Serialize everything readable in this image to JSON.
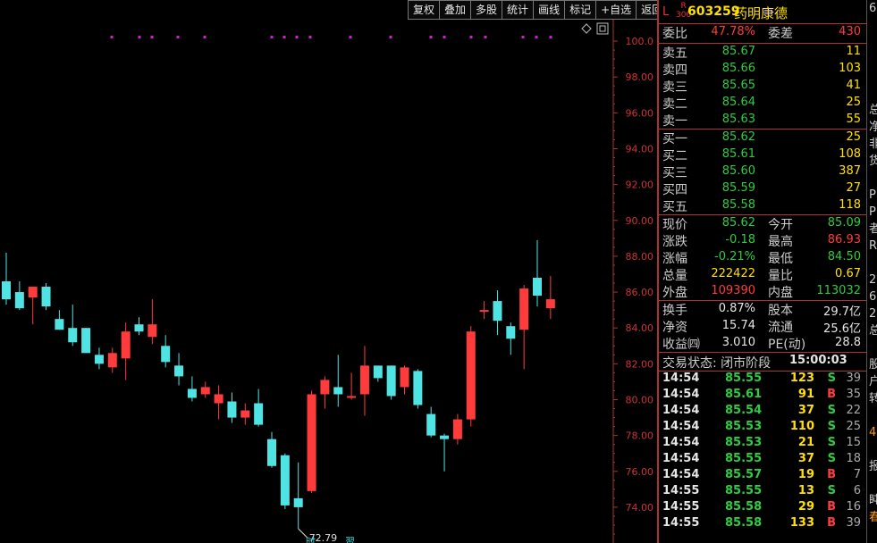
{
  "toolbar": {
    "buttons": [
      "复权",
      "叠加",
      "多股",
      "统计",
      "画线",
      "标记",
      "+自选",
      "返回"
    ]
  },
  "stock": {
    "market_l": "L",
    "market_r_top": "R",
    "market_r_bottom": "300",
    "code": "603259",
    "name": "药明康德"
  },
  "bid_ask_summary": {
    "ratio_label": "委比",
    "ratio_value": "47.78%",
    "diff_label": "委差",
    "diff_value": "430"
  },
  "asks": [
    {
      "label": "卖五",
      "price": "85.67",
      "vol": "11"
    },
    {
      "label": "卖四",
      "price": "85.66",
      "vol": "103"
    },
    {
      "label": "卖三",
      "price": "85.65",
      "vol": "41"
    },
    {
      "label": "卖二",
      "price": "85.64",
      "vol": "25"
    },
    {
      "label": "卖一",
      "price": "85.63",
      "vol": "55"
    }
  ],
  "bids": [
    {
      "label": "买一",
      "price": "85.62",
      "vol": "25"
    },
    {
      "label": "买二",
      "price": "85.61",
      "vol": "108"
    },
    {
      "label": "买三",
      "price": "85.60",
      "vol": "387"
    },
    {
      "label": "买四",
      "price": "85.59",
      "vol": "27"
    },
    {
      "label": "买五",
      "price": "85.58",
      "vol": "118"
    }
  ],
  "quote": [
    {
      "l1": "现价",
      "v1": "85.62",
      "c1": "green",
      "l2": "今开",
      "v2": "85.09",
      "c2": "green"
    },
    {
      "l1": "涨跌",
      "v1": "-0.18",
      "c1": "green",
      "l2": "最高",
      "v2": "86.93",
      "c2": "red"
    },
    {
      "l1": "涨幅",
      "v1": "-0.21%",
      "c1": "green",
      "l2": "最低",
      "v2": "84.50",
      "c2": "green"
    },
    {
      "l1": "总量",
      "v1": "222422",
      "c1": "yellow",
      "l2": "量比",
      "v2": "0.67",
      "c2": "yellow"
    },
    {
      "l1": "外盘",
      "v1": "109390",
      "c1": "red",
      "l2": "内盘",
      "v2": "113032",
      "c2": "green"
    }
  ],
  "fundamentals": [
    {
      "l1": "换手",
      "v1": "0.87%",
      "l2": "股本",
      "v2": "29.7亿"
    },
    {
      "l1": "净资",
      "v1": "15.74",
      "l2": "流通",
      "v2": "25.6亿"
    },
    {
      "l1": "收益㈣",
      "v1": "3.010",
      "l2": "PE(动)",
      "v2": "28.8"
    }
  ],
  "status": {
    "label": "交易状态: 闭市阶段",
    "time": "15:00:03"
  },
  "ticks": [
    {
      "time": "14:54",
      "price": "85.55",
      "vol": "123",
      "bs": "S",
      "n": "39"
    },
    {
      "time": "14:54",
      "price": "85.61",
      "vol": "91",
      "bs": "B",
      "n": "35"
    },
    {
      "time": "14:54",
      "price": "85.54",
      "vol": "37",
      "bs": "S",
      "n": "22"
    },
    {
      "time": "14:54",
      "price": "85.53",
      "vol": "110",
      "bs": "S",
      "n": "25"
    },
    {
      "time": "14:54",
      "price": "85.53",
      "vol": "21",
      "bs": "S",
      "n": "15"
    },
    {
      "time": "14:54",
      "price": "85.55",
      "vol": "37",
      "bs": "S",
      "n": "18"
    },
    {
      "time": "14:54",
      "price": "85.57",
      "vol": "19",
      "bs": "B",
      "n": "7"
    },
    {
      "time": "14:55",
      "price": "85.55",
      "vol": "13",
      "bs": "S",
      "n": "6"
    },
    {
      "time": "14:55",
      "price": "85.58",
      "vol": "29",
      "bs": "B",
      "n": "16"
    },
    {
      "time": "14:55",
      "price": "85.58",
      "vol": "133",
      "bs": "B",
      "n": "39"
    }
  ],
  "right_strip": [
    "6",
    "",
    "",
    "",
    "",
    "",
    "总",
    "净",
    "非",
    "货",
    "",
    "P",
    "P",
    "者",
    "R",
    "",
    "2",
    "6",
    "2",
    "总",
    "",
    "股",
    "户",
    "转",
    "",
    "4",
    "",
    "报",
    "",
    "盹",
    "春"
  ],
  "colors": {
    "up": "#ff3b3b",
    "down": "#4fe3e3",
    "axis": "#a33",
    "grid_label": "#c33",
    "marker": "#d020d0"
  },
  "chart_data": {
    "type": "candlestick",
    "y_axis_ticks": [
      "100.0",
      "98.00",
      "96.00",
      "94.00",
      "92.00",
      "90.00",
      "88.00",
      "86.00",
      "84.00",
      "82.00",
      "80.00",
      "78.00",
      "76.00",
      "74.00"
    ],
    "ylim": [
      73.0,
      100.6
    ],
    "min_label": "72.79",
    "bottom_labels": [
      "时",
      "習"
    ],
    "candles": [
      {
        "o": 86.6,
        "h": 88.2,
        "l": 85.3,
        "c": 85.6
      },
      {
        "o": 86.0,
        "h": 86.6,
        "l": 85.0,
        "c": 85.1
      },
      {
        "o": 85.7,
        "h": 86.3,
        "l": 84.2,
        "c": 86.3
      },
      {
        "o": 86.3,
        "h": 86.5,
        "l": 85.0,
        "c": 85.2
      },
      {
        "o": 84.5,
        "h": 85.0,
        "l": 83.9,
        "c": 83.9
      },
      {
        "o": 84.0,
        "h": 85.3,
        "l": 83.0,
        "c": 83.2
      },
      {
        "o": 84.0,
        "h": 84.0,
        "l": 82.6,
        "c": 82.6
      },
      {
        "o": 82.5,
        "h": 82.9,
        "l": 81.7,
        "c": 82.0
      },
      {
        "o": 81.8,
        "h": 82.9,
        "l": 81.5,
        "c": 82.6
      },
      {
        "o": 82.3,
        "h": 84.3,
        "l": 81.1,
        "c": 83.8
      },
      {
        "o": 84.2,
        "h": 84.6,
        "l": 83.6,
        "c": 83.8
      },
      {
        "o": 83.5,
        "h": 85.6,
        "l": 83.1,
        "c": 84.2
      },
      {
        "o": 83.0,
        "h": 83.6,
        "l": 81.8,
        "c": 82.1
      },
      {
        "o": 81.9,
        "h": 82.6,
        "l": 80.8,
        "c": 81.3
      },
      {
        "o": 80.6,
        "h": 81.3,
        "l": 79.9,
        "c": 80.1
      },
      {
        "o": 80.3,
        "h": 81.0,
        "l": 80.1,
        "c": 80.7
      },
      {
        "o": 79.8,
        "h": 80.8,
        "l": 78.9,
        "c": 80.3
      },
      {
        "o": 79.9,
        "h": 80.4,
        "l": 78.7,
        "c": 79.0
      },
      {
        "o": 79.0,
        "h": 79.8,
        "l": 78.6,
        "c": 79.4
      },
      {
        "o": 79.8,
        "h": 80.6,
        "l": 78.5,
        "c": 78.6
      },
      {
        "o": 77.8,
        "h": 78.2,
        "l": 76.2,
        "c": 76.3
      },
      {
        "o": 76.9,
        "h": 77.0,
        "l": 73.9,
        "c": 74.1
      },
      {
        "o": 74.5,
        "h": 76.5,
        "l": 72.8,
        "c": 74.0
      },
      {
        "o": 74.9,
        "h": 80.5,
        "l": 74.8,
        "c": 80.3
      },
      {
        "o": 80.3,
        "h": 81.3,
        "l": 79.5,
        "c": 81.1
      },
      {
        "o": 80.7,
        "h": 82.5,
        "l": 79.6,
        "c": 80.3
      },
      {
        "o": 80.1,
        "h": 81.5,
        "l": 80.0,
        "c": 80.2
      },
      {
        "o": 80.3,
        "h": 83.0,
        "l": 79.1,
        "c": 81.9
      },
      {
        "o": 81.9,
        "h": 81.9,
        "l": 81.0,
        "c": 81.2
      },
      {
        "o": 81.9,
        "h": 81.9,
        "l": 80.0,
        "c": 80.2
      },
      {
        "o": 80.7,
        "h": 81.9,
        "l": 80.3,
        "c": 81.8
      },
      {
        "o": 81.6,
        "h": 81.7,
        "l": 79.5,
        "c": 79.7
      },
      {
        "o": 79.2,
        "h": 79.6,
        "l": 77.9,
        "c": 78.0
      },
      {
        "o": 78.0,
        "h": 78.1,
        "l": 76.0,
        "c": 77.8
      },
      {
        "o": 77.8,
        "h": 79.2,
        "l": 77.5,
        "c": 78.9
      },
      {
        "o": 78.9,
        "h": 84.1,
        "l": 78.5,
        "c": 83.8
      },
      {
        "o": 84.9,
        "h": 85.5,
        "l": 84.5,
        "c": 85.0
      },
      {
        "o": 85.5,
        "h": 86.1,
        "l": 83.6,
        "c": 84.4
      },
      {
        "o": 84.1,
        "h": 84.3,
        "l": 82.5,
        "c": 83.4
      },
      {
        "o": 83.9,
        "h": 86.4,
        "l": 81.7,
        "c": 86.2
      },
      {
        "o": 86.8,
        "h": 88.9,
        "l": 85.2,
        "c": 85.8
      },
      {
        "o": 85.1,
        "h": 86.9,
        "l": 84.5,
        "c": 85.6
      }
    ],
    "marker_count": 19
  }
}
